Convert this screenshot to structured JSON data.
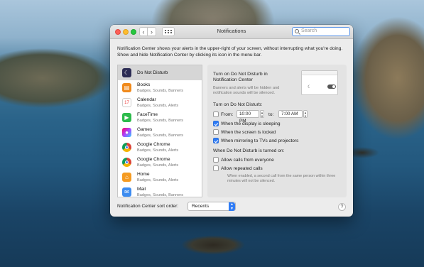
{
  "window": {
    "title": "Notifications"
  },
  "search": {
    "placeholder": "Search"
  },
  "description": "Notification Center shows your alerts in the upper-right of your screen, without interrupting what you're doing. Show and hide Notification Center by clicking its icon in the menu bar.",
  "apps": [
    {
      "name": "Do Not Disturb",
      "sub": "",
      "icon": "moon-icon",
      "color": "#2c2c54"
    },
    {
      "name": "Books",
      "sub": "Badges, Sounds, Banners",
      "icon": "books-icon",
      "color": "#f08a1c"
    },
    {
      "name": "Calendar",
      "sub": "Badges, Sounds, Alerts",
      "icon": "calendar-icon",
      "color": "#ffffff"
    },
    {
      "name": "FaceTime",
      "sub": "Badges, Sounds, Banners",
      "icon": "facetime-icon",
      "color": "#2dbb4b"
    },
    {
      "name": "Games",
      "sub": "Badges, Sounds, Banners",
      "icon": "games-icon",
      "color": "#d24fd0"
    },
    {
      "name": "Google Chrome",
      "sub": "Badges, Sounds, Alerts",
      "icon": "chrome-icon",
      "color": "#db4437"
    },
    {
      "name": "Google Chrome",
      "sub": "Badges, Sounds, Alerts",
      "icon": "chrome-icon",
      "color": "#db4437"
    },
    {
      "name": "Home",
      "sub": "Badges, Sounds, Alerts",
      "icon": "home-icon",
      "color": "#f59b22"
    },
    {
      "name": "Mail",
      "sub": "Badges, Sounds, Banners",
      "icon": "mail-icon",
      "color": "#3d8cf0"
    }
  ],
  "dnd": {
    "title": "Turn on Do Not Disturb in Notification Center",
    "subtitle": "Banners and alerts will be hidden and notification sounds will be silenced.",
    "turn_on_label": "Turn on Do Not Disturb:",
    "from_label": "From:",
    "from_time": "10:00 PM",
    "to_label": "to:",
    "to_time": "7:00 AM",
    "options": [
      {
        "label": "When the display is sleeping",
        "checked": true
      },
      {
        "label": "When the screen is locked",
        "checked": false
      },
      {
        "label": "When mirroring to TVs and projectors",
        "checked": true
      }
    ],
    "when_on_label": "When Do Not Disturb is turned on:",
    "allow_calls_label": "Allow calls from everyone",
    "allow_repeated_label": "Allow repeated calls",
    "repeated_note": "When enabled, a second call from the same person within three minutes will not be silenced."
  },
  "sort": {
    "label": "Notification Center sort order:",
    "value": "Recents"
  },
  "help": {
    "label": "?"
  }
}
